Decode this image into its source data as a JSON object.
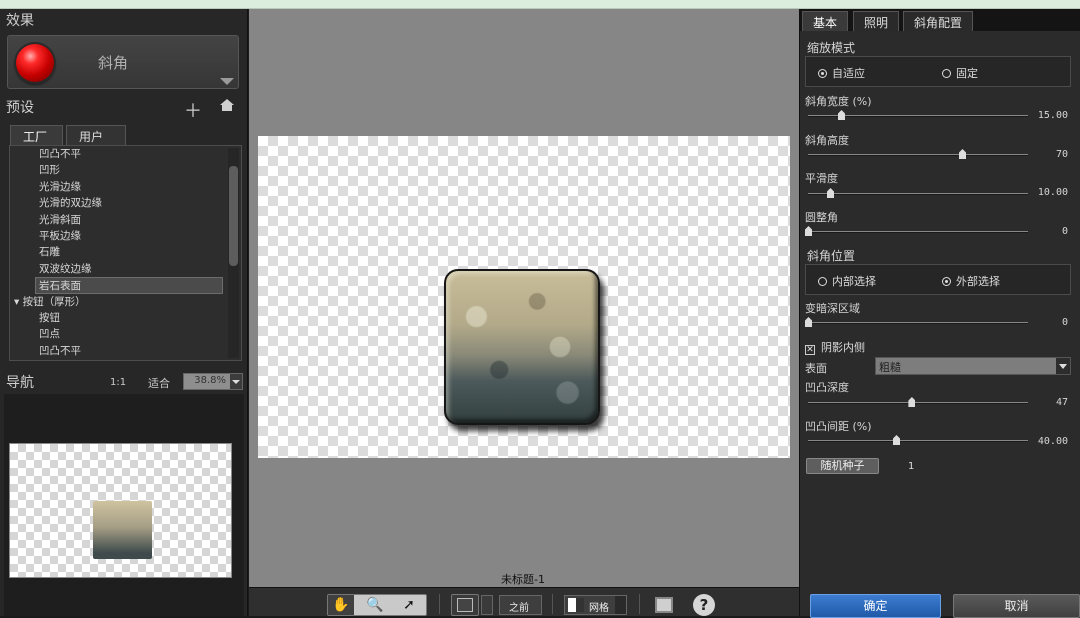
{
  "effects": {
    "title": "效果",
    "current": "斜角"
  },
  "presets": {
    "title": "预设",
    "tabs": [
      "工厂",
      "用户"
    ],
    "items": [
      {
        "label": "凹凸不平",
        "group": false,
        "selected": false
      },
      {
        "label": "凹形",
        "group": false,
        "selected": false
      },
      {
        "label": "光滑边缘",
        "group": false,
        "selected": false
      },
      {
        "label": "光滑的双边缘",
        "group": false,
        "selected": false
      },
      {
        "label": "光滑斜面",
        "group": false,
        "selected": false
      },
      {
        "label": "平板边缘",
        "group": false,
        "selected": false
      },
      {
        "label": "石雕",
        "group": false,
        "selected": false
      },
      {
        "label": "双波纹边缘",
        "group": false,
        "selected": false
      },
      {
        "label": "岩石表面",
        "group": false,
        "selected": true
      },
      {
        "label": "▾ 按钮（厚形）",
        "group": true,
        "selected": false
      },
      {
        "label": "按钮",
        "group": false,
        "selected": false
      },
      {
        "label": "凹点",
        "group": false,
        "selected": false
      },
      {
        "label": "凹凸不平",
        "group": false,
        "selected": false
      }
    ]
  },
  "navigator": {
    "title": "导航",
    "ratio": "1:1",
    "fit": "适合",
    "zoom": "38.8%"
  },
  "canvas": {
    "document_name": "未标题-1"
  },
  "toolbar": {
    "before": "之前",
    "grid": "网格"
  },
  "right_panel": {
    "tabs": [
      "基本",
      "照明",
      "斜角配置"
    ],
    "scale_mode": {
      "title": "缩放模式",
      "option1": "自适应",
      "option2": "固定"
    },
    "bevel_width": {
      "label": "斜角宽度 (%)",
      "value": "15.00",
      "fraction": 0.15
    },
    "bevel_height": {
      "label": "斜角高度",
      "value": "70",
      "fraction": 0.7
    },
    "smoothness": {
      "label": "平滑度",
      "value": "10.00",
      "fraction": 0.1
    },
    "round_corner": {
      "label": "圆整角",
      "value": "0",
      "fraction": 0
    },
    "bevel_position": {
      "title": "斜角位置",
      "option1": "内部选择",
      "option2": "外部选择"
    },
    "darken": {
      "label": "变暗深区域",
      "value": "0",
      "fraction": 0
    },
    "shadow_inner": {
      "label": "阴影内侧",
      "checked": true
    },
    "surface": {
      "label": "表面",
      "value": "粗糙"
    },
    "bump_depth": {
      "label": "凹凸深度",
      "value": "47",
      "fraction": 0.47
    },
    "bump_spacing": {
      "label": "凹凸间距 (%)",
      "value": "40.00",
      "fraction": 0.4
    },
    "random_seed": {
      "label": "随机种子",
      "value": "1"
    },
    "ok": "确定",
    "cancel": "取消"
  }
}
